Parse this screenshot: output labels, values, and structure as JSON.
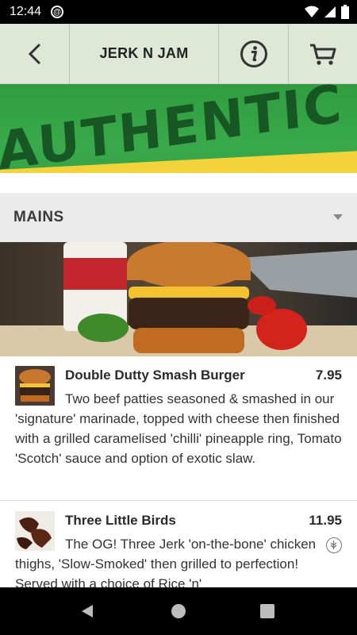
{
  "status_bar": {
    "time": "12:44"
  },
  "toolbar": {
    "title": "JERK N JAM"
  },
  "banner": {
    "headline": "AUTHENTIC JERK"
  },
  "category": {
    "label": "MAINS"
  },
  "items": [
    {
      "name": "Double Dutty Smash Burger",
      "price": "7.95",
      "description": "Two beef patties seasoned & smashed in our 'signature' marinade, topped with cheese then finished with a grilled caramelised 'chilli' pineapple ring, Tomato 'Scotch' sauce and option of exotic slaw."
    },
    {
      "name": "Three Little Birds",
      "price": "11.95",
      "description": "The OG! Three Jerk 'on-the-bone' chicken thighs, 'Slow-Smoked' then grilled to perfection! Served with a choice of Rice 'n'"
    }
  ],
  "colors": {
    "toolbar_bg": "#dfe8d6",
    "banner_green": "#39a94a",
    "banner_yellow": "#f3d23b",
    "category_bg": "#ebebeb"
  },
  "icons": [
    "back-arrow-icon",
    "info-icon",
    "cart-icon",
    "vegetarian-icon",
    "wifi-icon",
    "signal-icon",
    "battery-icon"
  ]
}
